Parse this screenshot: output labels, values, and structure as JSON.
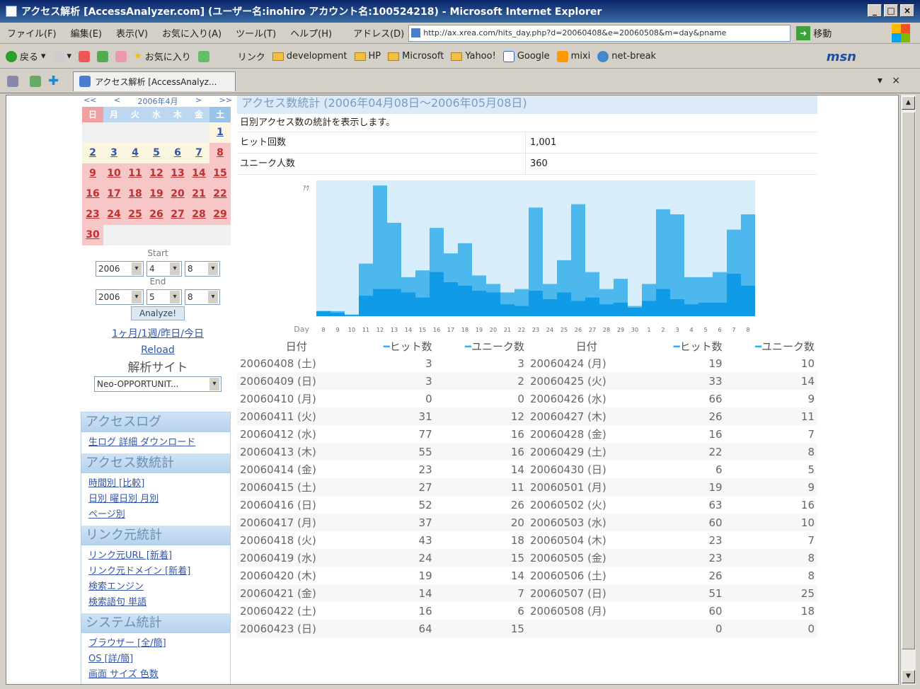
{
  "window": {
    "title": "アクセス解析 [AccessAnalyzer.com] (ユーザー名:inohiro アカウント名:100524218) - Microsoft Internet Explorer"
  },
  "menu": [
    "ファイル(F)",
    "編集(E)",
    "表示(V)",
    "お気に入り(A)",
    "ツール(T)",
    "ヘルプ(H)"
  ],
  "address": {
    "label": "アドレス(D)",
    "url": "http://ax.xrea.com/hits_day.php?d=20060408&e=20060508&m=day&pname",
    "go": "移動"
  },
  "toolbar": {
    "back": "戻る",
    "favorites": "お気に入り",
    "links_label": "リンク",
    "links": [
      "development",
      "HP",
      "Microsoft",
      "Yahoo!",
      "Google",
      "mixi",
      "net-break"
    ],
    "msn": "msn"
  },
  "tab": {
    "title": "アクセス解析 [AccessAnalyz..."
  },
  "sidebar": {
    "calendar": {
      "nav": [
        "<<",
        "<",
        "2006年4月",
        ">",
        ">>"
      ],
      "weekdays": [
        "日",
        "月",
        "火",
        "水",
        "木",
        "金",
        "土"
      ],
      "cells": [
        "",
        "",
        "",
        "",
        "",
        "",
        "1",
        "2",
        "3",
        "4",
        "5",
        "6",
        "7",
        "8",
        "9",
        "10",
        "11",
        "12",
        "13",
        "14",
        "15",
        "16",
        "17",
        "18",
        "19",
        "20",
        "21",
        "22",
        "23",
        "24",
        "25",
        "26",
        "27",
        "28",
        "29",
        "30",
        "",
        "",
        "",
        "",
        "",
        ""
      ]
    },
    "start_label": "Start",
    "end_label": "End",
    "start": {
      "year": "2006",
      "month": "4",
      "day": "8"
    },
    "end": {
      "year": "2006",
      "month": "5",
      "day": "8"
    },
    "analyze": "Analyze!",
    "links": "1ヶ月/1週/昨日/今日",
    "reload": "Reload",
    "site_label": "解析サイト",
    "site": "Neo-OPPORTUNIT...",
    "sections": [
      {
        "title": "アクセスログ",
        "lines": [
          "生ログ 詳細 ダウンロード"
        ]
      },
      {
        "title": "アクセス数統計",
        "lines": [
          "時間別 [比較]",
          "日別 曜日別 月別",
          "ページ別"
        ]
      },
      {
        "title": "リンク元統計",
        "lines": [
          "リンク元URL [新着]",
          "リンク元ドメイン [新着]",
          "検索エンジン",
          "検索語句 単語"
        ]
      },
      {
        "title": "システム統計",
        "lines": [
          "ブラウザー [全/簡]",
          "OS [詳/簡]",
          "画面 サイズ 色数"
        ]
      }
    ]
  },
  "main": {
    "header": "アクセス数統計 (2006年04月08日～2006年05月08日)",
    "note": "日別アクセス数の統計を表示します。",
    "hits_label": "ヒット回数",
    "hits": "1,001",
    "unique_label": "ユニーク人数",
    "unique": "360",
    "table_headers": [
      "日付",
      "ヒット数",
      "ユニーク数",
      "日付",
      "ヒット数",
      "ユニーク数"
    ],
    "rows": [
      [
        "20060408 (土)",
        "3",
        "3",
        "20060424 (月)",
        "19",
        "10"
      ],
      [
        "20060409 (日)",
        "3",
        "2",
        "20060425 (火)",
        "33",
        "14"
      ],
      [
        "20060410 (月)",
        "0",
        "0",
        "20060426 (水)",
        "66",
        "9"
      ],
      [
        "20060411 (火)",
        "31",
        "12",
        "20060427 (木)",
        "26",
        "11"
      ],
      [
        "20060412 (水)",
        "77",
        "16",
        "20060428 (金)",
        "16",
        "7"
      ],
      [
        "20060413 (木)",
        "55",
        "16",
        "20060429 (土)",
        "22",
        "8"
      ],
      [
        "20060414 (金)",
        "23",
        "14",
        "20060430 (日)",
        "6",
        "5"
      ],
      [
        "20060415 (土)",
        "27",
        "11",
        "20060501 (月)",
        "19",
        "9"
      ],
      [
        "20060416 (日)",
        "52",
        "26",
        "20060502 (火)",
        "63",
        "16"
      ],
      [
        "20060417 (月)",
        "37",
        "20",
        "20060503 (水)",
        "60",
        "10"
      ],
      [
        "20060418 (火)",
        "43",
        "18",
        "20060504 (木)",
        "23",
        "7"
      ],
      [
        "20060419 (水)",
        "24",
        "15",
        "20060505 (金)",
        "23",
        "8"
      ],
      [
        "20060420 (木)",
        "19",
        "14",
        "20060506 (土)",
        "26",
        "8"
      ],
      [
        "20060421 (金)",
        "14",
        "7",
        "20060507 (日)",
        "51",
        "25"
      ],
      [
        "20060422 (土)",
        "16",
        "6",
        "20060508 (月)",
        "60",
        "18"
      ],
      [
        "20060423 (日)",
        "64",
        "15",
        "",
        "0",
        "0"
      ]
    ]
  },
  "chart_data": {
    "type": "bar",
    "ylabel": "ｱｸ",
    "xlabel": "Day",
    "categories": [
      "8",
      "9",
      "10",
      "11",
      "12",
      "13",
      "14",
      "15",
      "16",
      "17",
      "18",
      "19",
      "20",
      "21",
      "22",
      "23",
      "24",
      "25",
      "26",
      "27",
      "28",
      "29",
      "30",
      "1",
      "2",
      "3",
      "4",
      "5",
      "6",
      "7",
      "8"
    ],
    "series": [
      {
        "name": "ヒット数",
        "values": [
          3,
          3,
          0,
          31,
          77,
          55,
          23,
          27,
          52,
          37,
          43,
          24,
          19,
          14,
          16,
          64,
          19,
          33,
          66,
          26,
          16,
          22,
          6,
          19,
          63,
          60,
          23,
          23,
          26,
          51,
          60
        ]
      },
      {
        "name": "ユニーク数",
        "values": [
          3,
          2,
          0,
          12,
          16,
          16,
          14,
          11,
          26,
          20,
          18,
          15,
          14,
          7,
          6,
          15,
          10,
          14,
          9,
          11,
          7,
          8,
          5,
          9,
          16,
          10,
          7,
          8,
          8,
          25,
          18
        ]
      }
    ],
    "colors": {
      "hits": "#4cb8ee",
      "unique": "#0f9be6",
      "plot_bg": "#d7eefa"
    },
    "ylim": [
      0,
      80
    ]
  }
}
